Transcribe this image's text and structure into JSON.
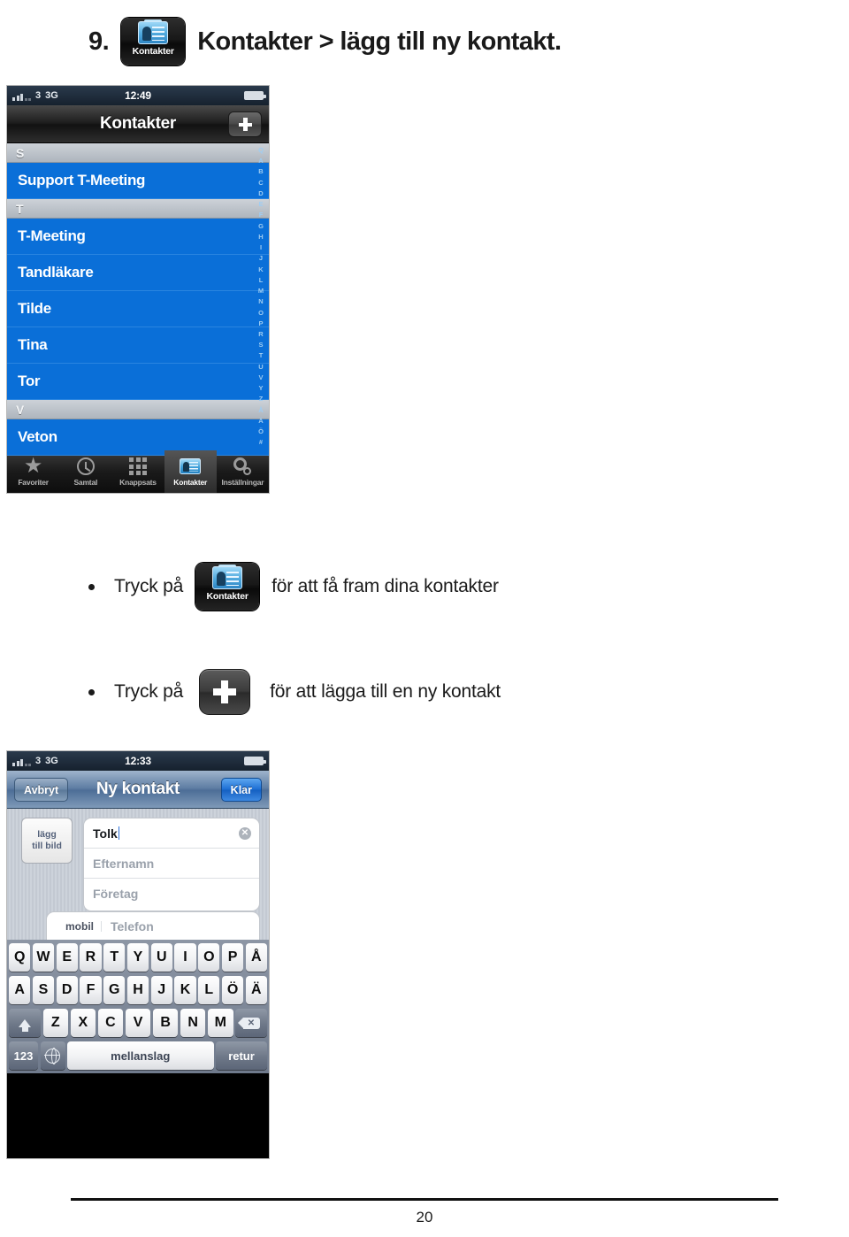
{
  "heading": {
    "number": "9.",
    "icon_label": "Kontakter",
    "text": "Kontakter > lägg till ny kontakt."
  },
  "contacts_screen": {
    "status_bar": {
      "carrier": "3",
      "network": "3G",
      "time": "12:49"
    },
    "nav": {
      "title": "Kontakter",
      "add_button": "+"
    },
    "list": [
      {
        "type": "section",
        "label": "S"
      },
      {
        "type": "contact",
        "label": "Support T-Meeting"
      },
      {
        "type": "section",
        "label": "T"
      },
      {
        "type": "contact",
        "label": "T-Meeting"
      },
      {
        "type": "contact",
        "label": "Tandläkare"
      },
      {
        "type": "contact",
        "label": "Tilde"
      },
      {
        "type": "contact",
        "label": "Tina"
      },
      {
        "type": "contact",
        "label": "Tor"
      },
      {
        "type": "section",
        "label": "V"
      },
      {
        "type": "contact",
        "label": "Veton"
      }
    ],
    "index_strip": [
      "Q",
      "A",
      "B",
      "C",
      "D",
      "E",
      "F",
      "G",
      "H",
      "I",
      "J",
      "K",
      "L",
      "M",
      "N",
      "O",
      "P",
      "R",
      "S",
      "T",
      "U",
      "V",
      "Y",
      "Z",
      "Å",
      "Ä",
      "Ö",
      "#"
    ],
    "tabs": [
      {
        "label": "Favoriter",
        "icon": "star-icon",
        "active": false
      },
      {
        "label": "Samtal",
        "icon": "clock-icon",
        "active": false
      },
      {
        "label": "Knappsats",
        "icon": "keypad-icon",
        "active": false
      },
      {
        "label": "Kontakter",
        "icon": "contacts-card-icon",
        "active": true
      },
      {
        "label": "Inställningar",
        "icon": "gear-icon",
        "active": false
      }
    ]
  },
  "bullets": [
    {
      "before": "Tryck på",
      "icon": "kontakter-app-icon",
      "icon_label": "Kontakter",
      "after": "för att få fram dina kontakter"
    },
    {
      "before": "Tryck på",
      "icon": "plus-button-icon",
      "after": "för att lägga till en ny kontakt"
    }
  ],
  "new_contact_screen": {
    "status_bar": {
      "carrier": "3",
      "network": "3G",
      "time": "12:33"
    },
    "nav": {
      "cancel": "Avbryt",
      "title": "Ny kontakt",
      "done": "Klar"
    },
    "photo_button": {
      "line1": "lägg",
      "line2": "till bild"
    },
    "fields": [
      {
        "name": "first-name",
        "value": "Tolk",
        "placeholder": "",
        "has_clear": true
      },
      {
        "name": "last-name",
        "value": "",
        "placeholder": "Efternamn",
        "has_clear": false
      },
      {
        "name": "company",
        "value": "",
        "placeholder": "Företag",
        "has_clear": false
      }
    ],
    "phone_field": {
      "label": "mobil",
      "placeholder": "Telefon"
    },
    "keyboard": {
      "row1": [
        "Q",
        "W",
        "E",
        "R",
        "T",
        "Y",
        "U",
        "I",
        "O",
        "P",
        "Å"
      ],
      "row2": [
        "A",
        "S",
        "D",
        "F",
        "G",
        "H",
        "J",
        "K",
        "L",
        "Ö",
        "Ä"
      ],
      "row3": [
        "Z",
        "X",
        "C",
        "V",
        "B",
        "N",
        "M"
      ],
      "shift": "shift-icon",
      "delete": "backspace-icon",
      "numbers": "123",
      "globe": "globe-icon",
      "space": "mellanslag",
      "return": "retur"
    }
  },
  "footer": {
    "page_number": "20"
  }
}
